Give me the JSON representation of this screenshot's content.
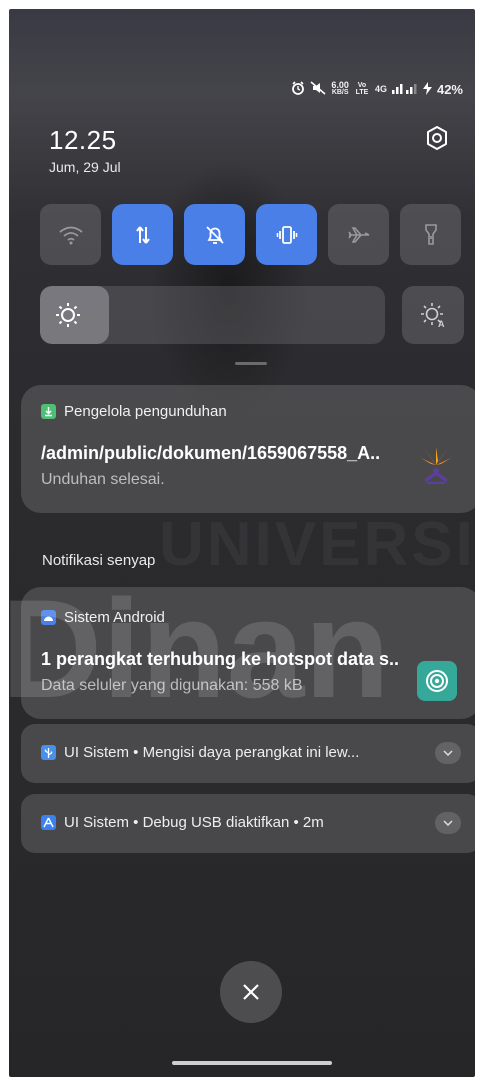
{
  "status_bar": {
    "speed_value": "6.00",
    "speed_unit": "KB/S",
    "volte": "Vo LTE",
    "network": "4G",
    "battery": "42%"
  },
  "header": {
    "time": "12.25",
    "date": "Jum, 29 Jul"
  },
  "quick_settings": {
    "tiles": [
      {
        "name": "wifi",
        "on": false
      },
      {
        "name": "mobile-data",
        "on": true
      },
      {
        "name": "do-not-disturb",
        "on": true
      },
      {
        "name": "vibrate",
        "on": true
      },
      {
        "name": "airplane-mode",
        "on": false
      },
      {
        "name": "flashlight",
        "on": false
      }
    ],
    "brightness_level": 0.2
  },
  "watermark": {
    "text1": "UNIVERSIT",
    "text2": "Dinan"
  },
  "notifications": {
    "download": {
      "app": "Pengelola pengunduhan",
      "title": "/admin/public/dokumen/1659067558_A..",
      "subtitle": "Unduhan selesai."
    },
    "silent_label": "Notifikasi senyap",
    "hotspot": {
      "app": "Sistem Android",
      "title": "1 perangkat terhubung ke hotspot data s..",
      "subtitle": "Data seluler yang digunakan: 558 kB"
    },
    "charging": {
      "text": "UI Sistem • Mengisi daya perangkat ini lew..."
    },
    "usb_debug": {
      "text": "UI Sistem • Debug USB diaktifkan • 2m"
    }
  },
  "colors": {
    "accent": "#4a7fe8",
    "hotspot_icon": "#36a89a",
    "download_badge": "#4fbf75"
  }
}
